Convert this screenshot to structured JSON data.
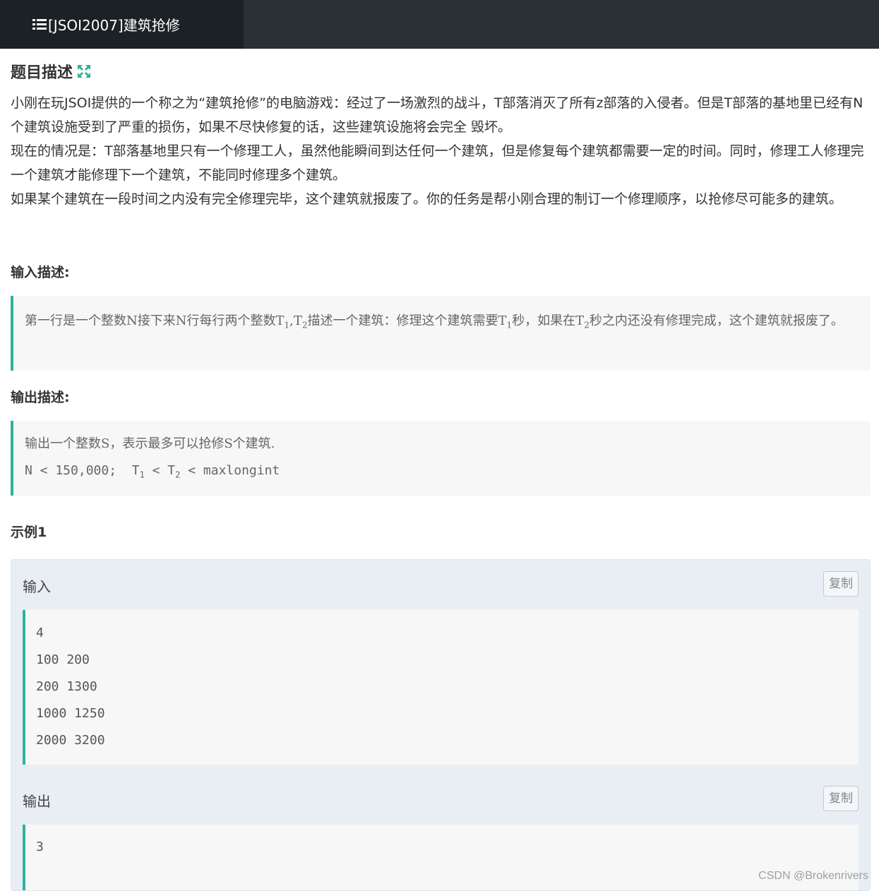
{
  "header": {
    "tab_title": "[JSOI2007]建筑抢修"
  },
  "problem": {
    "title": "题目描述",
    "description": [
      "小刚在玩JSOI提供的一个称之为“建筑抢修”的电脑游戏：经过了一场激烈的战斗，T部落消灭了所有z部落的入侵者。但是T部落的基地里已经有N个建筑设施受到了严重的损伤，如果不尽快修复的话，这些建筑设施将会完全 毁坏。",
      "现在的情况是：T部落基地里只有一个修理工人，虽然他能瞬间到达任何一个建筑，但是修复每个建筑都需要一定的时间。同时，修理工人修理完一个建筑才能修理下一个建筑，不能同时修理多个建筑。",
      "如果某个建筑在一段时间之内没有完全修理完毕，这个建筑就报废了。你的任务是帮小刚合理的制订一个修理顺序，以抢修尽可能多的建筑。"
    ]
  },
  "input_section": {
    "title": "输入描述:",
    "parts": {
      "a": "第一行是一个整数N接下来N行每行两个整数T",
      "sub1": "1",
      "b": ",T",
      "sub2": "2",
      "c": "描述一个建筑：修理这个建筑需要T",
      "sub3": "1",
      "d": "秒，如果在T",
      "sub4": "2",
      "e": "秒之内还没有修理完成，这个建筑就报废了。"
    }
  },
  "output_section": {
    "title": "输出描述:",
    "line1": "输出一个整数S，表示最多可以抢修S个建筑.",
    "line2": {
      "a": "N < 150,000;  T",
      "sub1": "1",
      "b": " < T",
      "sub2": "2",
      "c": " < maxlongint"
    }
  },
  "example": {
    "title": "示例1",
    "input_label": "输入",
    "output_label": "输出",
    "copy_label": "复制",
    "input_lines": [
      "4",
      "100 200",
      "200 1300",
      "1000 1250",
      "2000 3200"
    ],
    "output_lines": [
      "3"
    ]
  },
  "watermark": "CSDN @Brokenrivers"
}
